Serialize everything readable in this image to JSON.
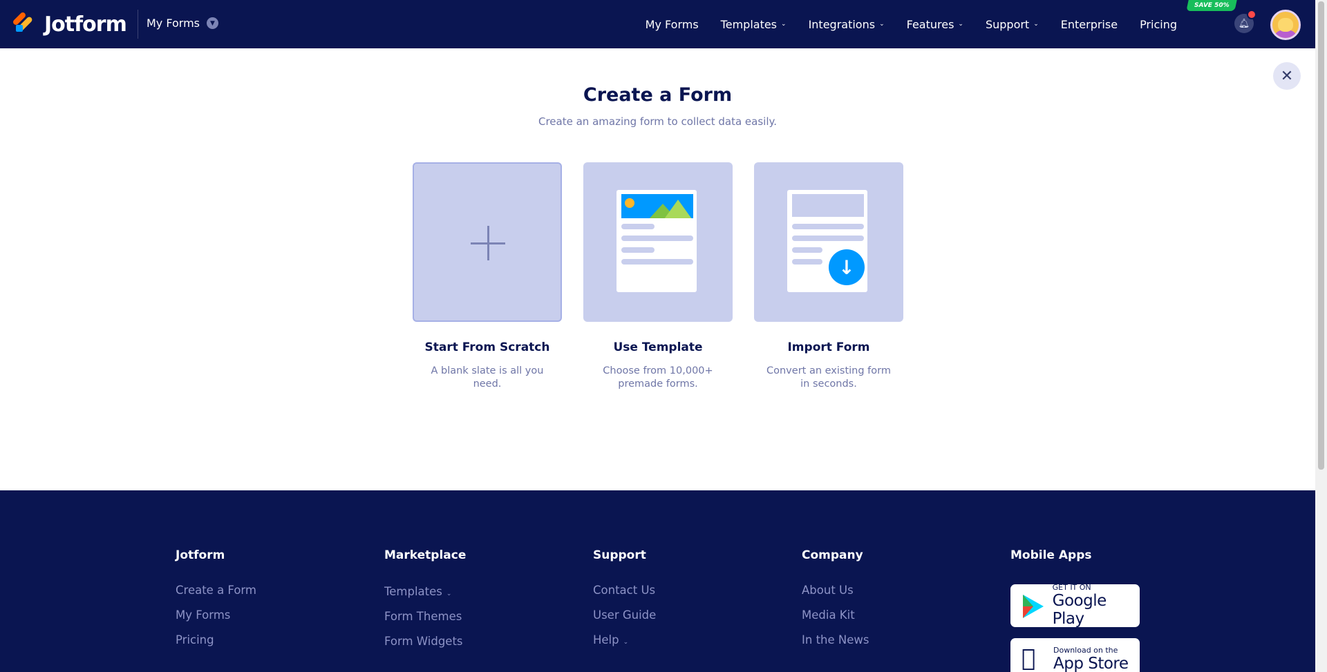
{
  "header": {
    "brand_name": "Jotform",
    "myforms_switch": "My Forms",
    "nav": [
      {
        "label": "My Forms",
        "has_caret": false
      },
      {
        "label": "Templates",
        "has_caret": true
      },
      {
        "label": "Integrations",
        "has_caret": true
      },
      {
        "label": "Features",
        "has_caret": true
      },
      {
        "label": "Support",
        "has_caret": true
      },
      {
        "label": "Enterprise",
        "has_caret": false
      },
      {
        "label": "Pricing",
        "has_caret": false
      }
    ],
    "save_badge": "SAVE 50%",
    "caret_glyph": "⌄",
    "colors": {
      "navy": "#0a1551",
      "accent_orange": "#ff6100",
      "accent_yellow": "#ffb629",
      "accent_blue": "#0099ff",
      "badge_green": "#18bd5b",
      "notification_red": "#ff4948"
    }
  },
  "main": {
    "title": "Create a Form",
    "subtitle": "Create an amazing form to collect data easily.",
    "close_glyph": "✕",
    "cards": [
      {
        "label": "Start From Scratch",
        "desc": "A blank slate is all you need.",
        "icon": "plus-icon"
      },
      {
        "label": "Use Template",
        "desc": "Choose from 10,000+ premade forms.",
        "icon": "template-document-icon"
      },
      {
        "label": "Import Form",
        "desc": "Convert an existing form in seconds.",
        "icon": "import-document-icon"
      }
    ]
  },
  "footer": {
    "columns": [
      {
        "title": "Jotform",
        "links": [
          "Create a Form",
          "My Forms",
          "Pricing"
        ]
      },
      {
        "title": "Marketplace",
        "links": [
          "Templates",
          "Form Themes",
          "Form Widgets"
        ]
      },
      {
        "title": "Support",
        "links": [
          "Contact Us",
          "User Guide",
          "Help"
        ]
      },
      {
        "title": "Company",
        "links": [
          "About Us",
          "Media Kit",
          "In the News"
        ]
      }
    ],
    "mobile_apps": {
      "title": "Mobile Apps",
      "google_small": "GET IT ON",
      "google_big": "Google Play",
      "apple_small": "Download on the",
      "apple_big": "App Store"
    }
  }
}
